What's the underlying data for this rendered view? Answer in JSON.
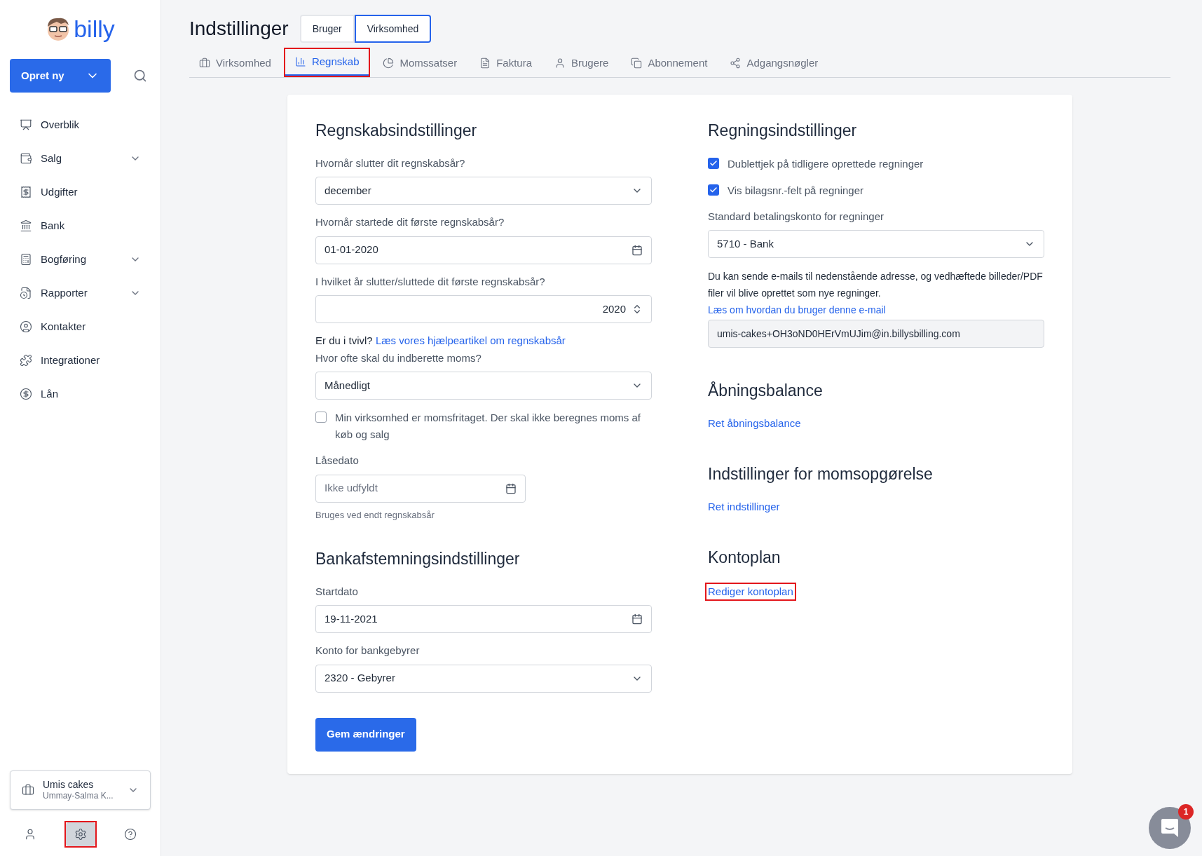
{
  "sidebar": {
    "logo": "billy",
    "create_button": "Opret ny",
    "items": [
      {
        "label": "Overblik",
        "expandable": false
      },
      {
        "label": "Salg",
        "expandable": true
      },
      {
        "label": "Udgifter",
        "expandable": false
      },
      {
        "label": "Bank",
        "expandable": false
      },
      {
        "label": "Bogføring",
        "expandable": true
      },
      {
        "label": "Rapporter",
        "expandable": true
      },
      {
        "label": "Kontakter",
        "expandable": false
      },
      {
        "label": "Integrationer",
        "expandable": false
      },
      {
        "label": "Lån",
        "expandable": false
      }
    ],
    "company": {
      "name": "Umis cakes",
      "owner": "Ummay-Salma K..."
    },
    "footer_buttons": [
      {
        "selected": false,
        "highlighted": false
      },
      {
        "selected": true,
        "highlighted": true
      },
      {
        "selected": false,
        "highlighted": false
      }
    ]
  },
  "page": {
    "title": "Indstillinger",
    "scope_tabs": [
      {
        "label": "Bruger",
        "selected": false
      },
      {
        "label": "Virksomhed",
        "selected": true
      }
    ],
    "tabs": [
      {
        "label": "Virksomhed",
        "selected": false,
        "highlighted": false
      },
      {
        "label": "Regnskab",
        "selected": true,
        "highlighted": true
      },
      {
        "label": "Momssatser",
        "selected": false,
        "highlighted": false
      },
      {
        "label": "Faktura",
        "selected": false,
        "highlighted": false
      },
      {
        "label": "Brugere",
        "selected": false,
        "highlighted": false
      },
      {
        "label": "Abonnement",
        "selected": false,
        "highlighted": false
      },
      {
        "label": "Adgangsnøgler",
        "selected": false,
        "highlighted": false
      }
    ]
  },
  "left_sections": [
    {
      "heading": "Regnskabsindstillinger",
      "fields": [
        {
          "kind": "select",
          "label": "Hvornår slutter dit regnskabsår?",
          "value": "december"
        },
        {
          "kind": "date",
          "label": "Hvornår startede dit første regnskabsår?",
          "value": "01-01-2020"
        },
        {
          "kind": "number",
          "label": "I hvilket år slutter/sluttede dit første regnskabsår?",
          "value": "2020"
        },
        {
          "kind": "help",
          "text": "Er du i tvivl?",
          "link": "Læs vores hjælpeartikel om regnskabsår"
        },
        {
          "kind": "select",
          "label": "Hvor ofte skal du indberette moms?",
          "value": "Månedligt"
        },
        {
          "kind": "checkbox",
          "label": "Min virksomhed er momsfritaget. Der skal ikke beregnes moms af køb og salg",
          "checked": false
        },
        {
          "kind": "date",
          "label": "Låsedato",
          "placeholder": "Ikke udfyldt",
          "hint": "Bruges ved endt regnskabsår"
        }
      ]
    },
    {
      "heading": "Bankafstemningsindstillinger",
      "fields": [
        {
          "kind": "date",
          "label": "Startdato",
          "value": "19-11-2021"
        },
        {
          "kind": "select",
          "label": "Konto for bankgebyrer",
          "value": "2320 - Gebyrer"
        }
      ]
    }
  ],
  "save_button": "Gem ændringer",
  "right_sections": [
    {
      "heading": "Regningsindstillinger",
      "fields": [
        {
          "kind": "checkbox",
          "label": "Dublettjek på tidligere oprettede regninger",
          "checked": true
        },
        {
          "kind": "checkbox",
          "label": "Vis bilagsnr.-felt på regninger",
          "checked": true
        },
        {
          "kind": "select",
          "label": "Standard betalingskonto for regninger",
          "value": "5710 - Bank"
        },
        {
          "kind": "info",
          "text": "Du kan sende e-mails til nedenstående adresse, og vedhæftede billeder/PDF filer vil blive oprettet som nye regninger.",
          "link": "Læs om hvordan du bruger denne e-mail"
        },
        {
          "kind": "readonly",
          "value": "umis-cakes+OH3oND0HErVmUJim@in.billysbilling.com"
        }
      ]
    },
    {
      "heading": "Åbningsbalance",
      "fields": [
        {
          "kind": "link",
          "link": "Ret åbningsbalance",
          "highlighted": false
        }
      ]
    },
    {
      "heading": "Indstillinger for momsopgørelse",
      "fields": [
        {
          "kind": "link",
          "link": "Ret indstillinger",
          "highlighted": false
        }
      ]
    },
    {
      "heading": "Kontoplan",
      "fields": [
        {
          "kind": "link",
          "link": "Rediger kontoplan",
          "highlighted": true
        }
      ]
    }
  ],
  "chat": {
    "badge": "1"
  }
}
